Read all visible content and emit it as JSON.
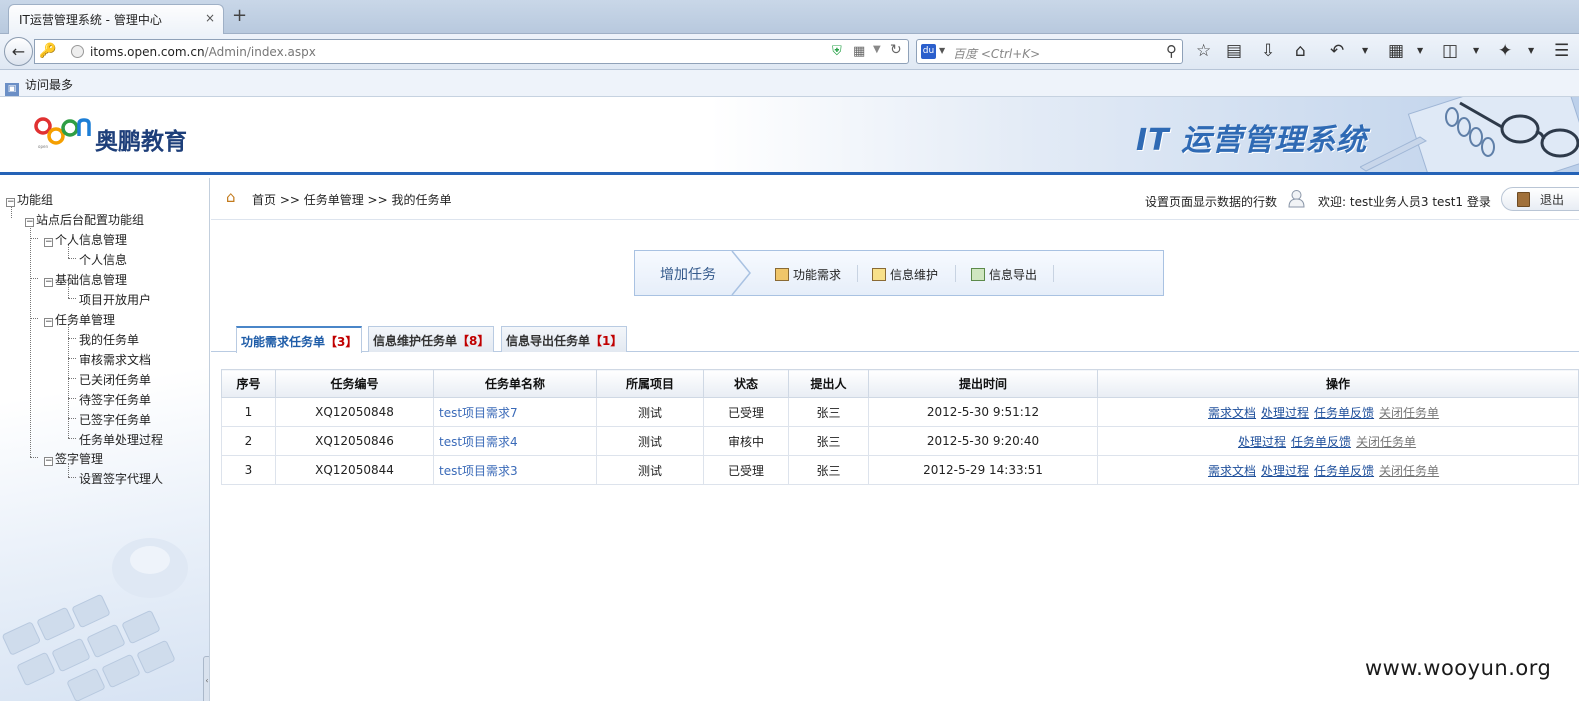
{
  "browser": {
    "tab_title": "IT运营管理系统 - 管理中心",
    "tab_close": "×",
    "new_tab": "+",
    "url_domain": "itoms.open.com.cn",
    "url_path": "/Admin/index.aspx",
    "search_placeholder": "百度 <Ctrl+K>",
    "search_engine_label": "du",
    "bookmark_label": "访问最多"
  },
  "header": {
    "logo_mark": "open",
    "logo_text": "奥鹏教育",
    "system_title": "IT 运营管理系统"
  },
  "sidebar": {
    "root": "功能组",
    "group": "站点后台配置功能组",
    "sections": [
      {
        "label": "个人信息管理",
        "items": [
          "个人信息"
        ]
      },
      {
        "label": "基础信息管理",
        "items": [
          "项目开放用户"
        ]
      },
      {
        "label": "任务单管理",
        "items": [
          "我的任务单",
          "审核需求文档",
          "已关闭任务单",
          "待签字任务单",
          "已签字任务单",
          "任务单处理过程"
        ]
      },
      {
        "label": "签字管理",
        "items": [
          "设置签字代理人"
        ]
      }
    ],
    "splitter_glyph": "‹"
  },
  "topbar": {
    "breadcrumb": "首页 >> 任务单管理 >> 我的任务单",
    "rows_setting": "设置页面显示数据的行数",
    "welcome": "欢迎: test业务人员3 test1 登录",
    "logout": "退出"
  },
  "addbar": {
    "title": "增加任务",
    "links": [
      "功能需求",
      "信息维护",
      "信息导出"
    ]
  },
  "tabs": [
    {
      "label": "功能需求任务单",
      "count": "【3】",
      "active": true
    },
    {
      "label": "信息维护任务单",
      "count": "【8】",
      "active": false
    },
    {
      "label": "信息导出任务单",
      "count": "【1】",
      "active": false
    }
  ],
  "table": {
    "headers": [
      "序号",
      "任务编号",
      "任务单名称",
      "所属项目",
      "状态",
      "提出人",
      "提出时间",
      "操作"
    ],
    "rows": [
      {
        "no": "1",
        "code": "XQ12050848",
        "name": "test项目需求7",
        "project": "测试",
        "status": "已受理",
        "submitter": "张三",
        "time": "2012-5-30 9:51:12",
        "ops": [
          "需求文档",
          "处理过程",
          "任务单反馈",
          "关闭任务单"
        ]
      },
      {
        "no": "2",
        "code": "XQ12050846",
        "name": "test项目需求4",
        "project": "测试",
        "status": "审核中",
        "submitter": "张三",
        "time": "2012-5-30 9:20:40",
        "ops": [
          "处理过程",
          "任务单反馈",
          "关闭任务单"
        ]
      },
      {
        "no": "3",
        "code": "XQ12050844",
        "name": "test项目需求3",
        "project": "测试",
        "status": "已受理",
        "submitter": "张三",
        "time": "2012-5-29 14:33:51",
        "ops": [
          "需求文档",
          "处理过程",
          "任务单反馈",
          "关闭任务单"
        ]
      }
    ]
  },
  "watermark": "www.wooyun.org",
  "colors": {
    "accent": "#2563b7",
    "link": "#1e4f9b",
    "count_red": "#c00000"
  }
}
